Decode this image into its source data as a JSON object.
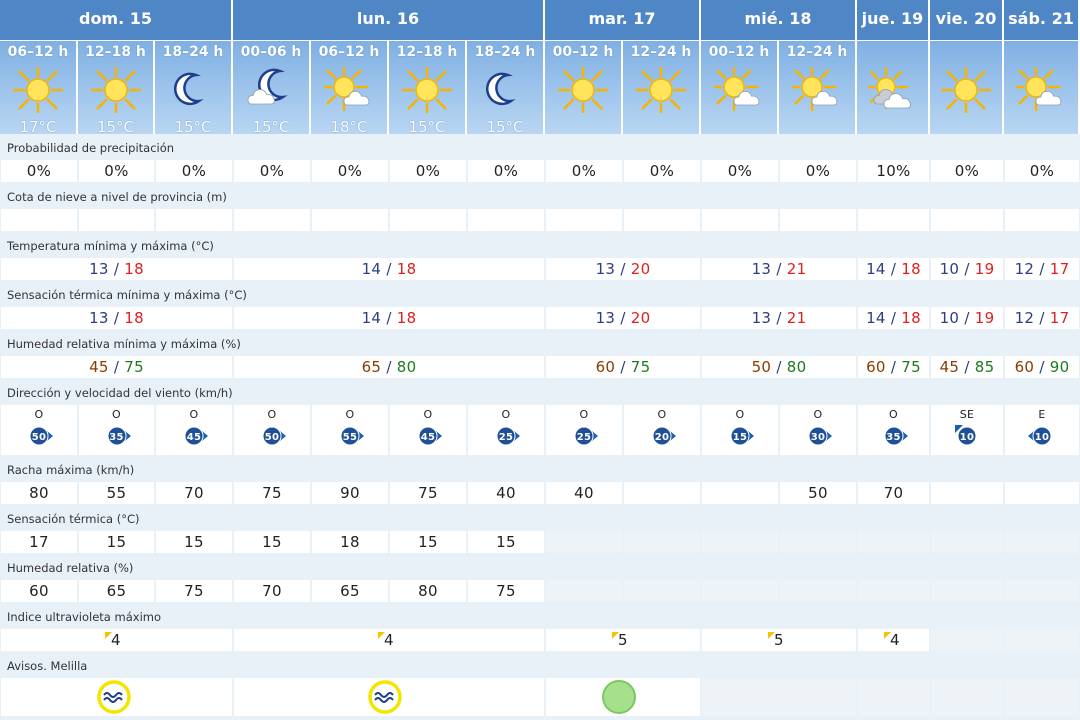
{
  "days": [
    {
      "label": "dom. 15"
    },
    {
      "label": "lun. 16"
    },
    {
      "label": "mar. 17"
    },
    {
      "label": "mié. 18"
    },
    {
      "label": "jue. 19"
    },
    {
      "label": "vie. 20"
    },
    {
      "label": "sáb. 21"
    }
  ],
  "periods": [
    {
      "label": "06–12 h",
      "icon": "sun-icon",
      "temp": "17°C"
    },
    {
      "label": "12–18 h",
      "icon": "sun-icon",
      "temp": "15°C"
    },
    {
      "label": "18–24 h",
      "icon": "moon-icon",
      "temp": "15°C"
    },
    {
      "label": "00–06 h",
      "icon": "moon-cloud-icon",
      "temp": "15°C"
    },
    {
      "label": "06–12 h",
      "icon": "sun-cloud-icon",
      "temp": "18°C"
    },
    {
      "label": "12–18 h",
      "icon": "sun-icon",
      "temp": "15°C"
    },
    {
      "label": "18–24 h",
      "icon": "moon-icon",
      "temp": "15°C"
    },
    {
      "label": "00–12 h",
      "icon": "sun-icon",
      "temp": ""
    },
    {
      "label": "12–24 h",
      "icon": "sun-icon",
      "temp": ""
    },
    {
      "label": "00–12 h",
      "icon": "sun-cloud-icon",
      "temp": ""
    },
    {
      "label": "12–24 h",
      "icon": "sun-cloud-icon",
      "temp": ""
    },
    {
      "label": "",
      "icon": "sun-cloud-grey-icon",
      "temp": ""
    },
    {
      "label": "",
      "icon": "sun-icon",
      "temp": ""
    },
    {
      "label": "",
      "icon": "sun-cloud-icon",
      "temp": ""
    }
  ],
  "rows": {
    "precip": {
      "label": "Probabilidad de precipitación",
      "values": [
        "0%",
        "0%",
        "0%",
        "0%",
        "0%",
        "0%",
        "0%",
        "0%",
        "0%",
        "0%",
        "0%",
        "10%",
        "0%",
        "0%"
      ]
    },
    "snow": {
      "label": "Cota de nieve a nivel de provincia (m)"
    },
    "temp": {
      "label": "Temperatura mínima y máxima (°C)",
      "values": [
        {
          "min": "13",
          "max": "18"
        },
        {
          "min": "14",
          "max": "18"
        },
        {
          "min": "13",
          "max": "20"
        },
        {
          "min": "13",
          "max": "21"
        },
        {
          "min": "14",
          "max": "18"
        },
        {
          "min": "10",
          "max": "19"
        },
        {
          "min": "12",
          "max": "17"
        }
      ]
    },
    "feels": {
      "label": "Sensación térmica mínima y máxima (°C)",
      "values": [
        {
          "min": "13",
          "max": "18"
        },
        {
          "min": "14",
          "max": "18"
        },
        {
          "min": "13",
          "max": "20"
        },
        {
          "min": "13",
          "max": "21"
        },
        {
          "min": "14",
          "max": "18"
        },
        {
          "min": "10",
          "max": "19"
        },
        {
          "min": "12",
          "max": "17"
        }
      ]
    },
    "humidity": {
      "label": "Humedad relativa mínima y máxima (%)",
      "values": [
        {
          "min": "45",
          "max": "75"
        },
        {
          "min": "65",
          "max": "80"
        },
        {
          "min": "60",
          "max": "75"
        },
        {
          "min": "50",
          "max": "80"
        },
        {
          "min": "60",
          "max": "75"
        },
        {
          "min": "45",
          "max": "85"
        },
        {
          "min": "60",
          "max": "90"
        }
      ]
    },
    "wind": {
      "label": "Dirección y velocidad del viento (km/h)",
      "values": [
        {
          "dir": "O",
          "speed": "50"
        },
        {
          "dir": "O",
          "speed": "35"
        },
        {
          "dir": "O",
          "speed": "45"
        },
        {
          "dir": "O",
          "speed": "50"
        },
        {
          "dir": "O",
          "speed": "55"
        },
        {
          "dir": "O",
          "speed": "45"
        },
        {
          "dir": "O",
          "speed": "25"
        },
        {
          "dir": "O",
          "speed": "25"
        },
        {
          "dir": "O",
          "speed": "20"
        },
        {
          "dir": "O",
          "speed": "15"
        },
        {
          "dir": "O",
          "speed": "30"
        },
        {
          "dir": "O",
          "speed": "35"
        },
        {
          "dir": "SE",
          "speed": "10"
        },
        {
          "dir": "E",
          "speed": "10"
        }
      ]
    },
    "gust": {
      "label": "Racha máxima (km/h)",
      "values": [
        "80",
        "55",
        "70",
        "75",
        "90",
        "75",
        "40",
        "40",
        "",
        "",
        "50",
        "70",
        "",
        ""
      ]
    },
    "feel_period": {
      "label": "Sensación térmica (°C)",
      "values": [
        "17",
        "15",
        "15",
        "15",
        "18",
        "15",
        "15"
      ]
    },
    "hum_period": {
      "label": "Humedad relativa (%)",
      "values": [
        "60",
        "65",
        "75",
        "70",
        "65",
        "80",
        "75"
      ]
    },
    "uv": {
      "label": "Indice ultravioleta máximo",
      "values": [
        "4",
        "4",
        "5",
        "5",
        "4"
      ]
    },
    "warnings": {
      "label": "Avisos. Melilla"
    }
  },
  "colors": {
    "header": "#4f86c6",
    "temp_max": "#e02020",
    "temp_min": "#2c3e80",
    "hum_max": "#1d7a1d",
    "hum_min": "#8a3b00",
    "warning_yellow": "#f2e600",
    "warning_green": "#a6e08a"
  }
}
